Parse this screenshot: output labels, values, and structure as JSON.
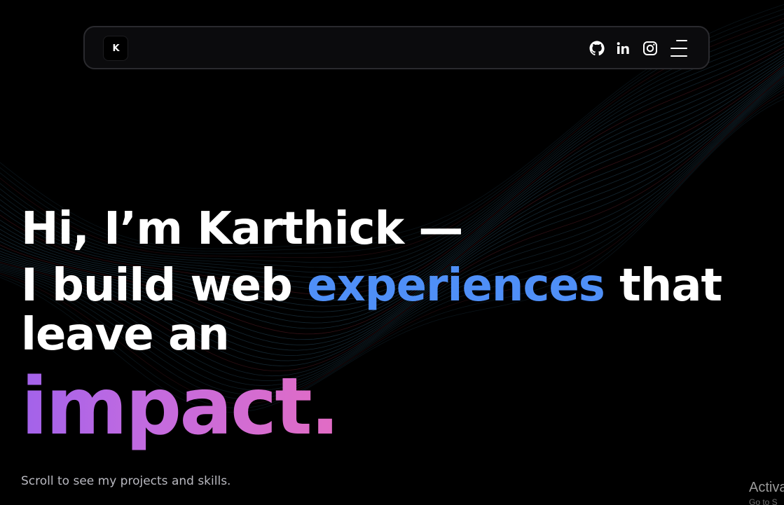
{
  "navbar": {
    "logo_text": "K",
    "icons": [
      "github-icon",
      "linkedin-icon",
      "instagram-icon",
      "menu-icon"
    ]
  },
  "hero": {
    "line1": "Hi, I’m Karthick —",
    "line2_start": "I build web ",
    "line2_accent": "experiences",
    "line2_end": " that leave an",
    "line3": "impact."
  },
  "caption": "Scroll to see my projects and skills.",
  "system_overlay": {
    "activate_text": "Activa",
    "activate_sub": "Go to S"
  },
  "colors": {
    "background": "#000000",
    "accent_blue": "#4f8ff7",
    "gradient_start": "#a262ea",
    "gradient_end": "#e26cc4",
    "wave_color": "#1e3a4a",
    "wave_red": "#4a1820"
  }
}
